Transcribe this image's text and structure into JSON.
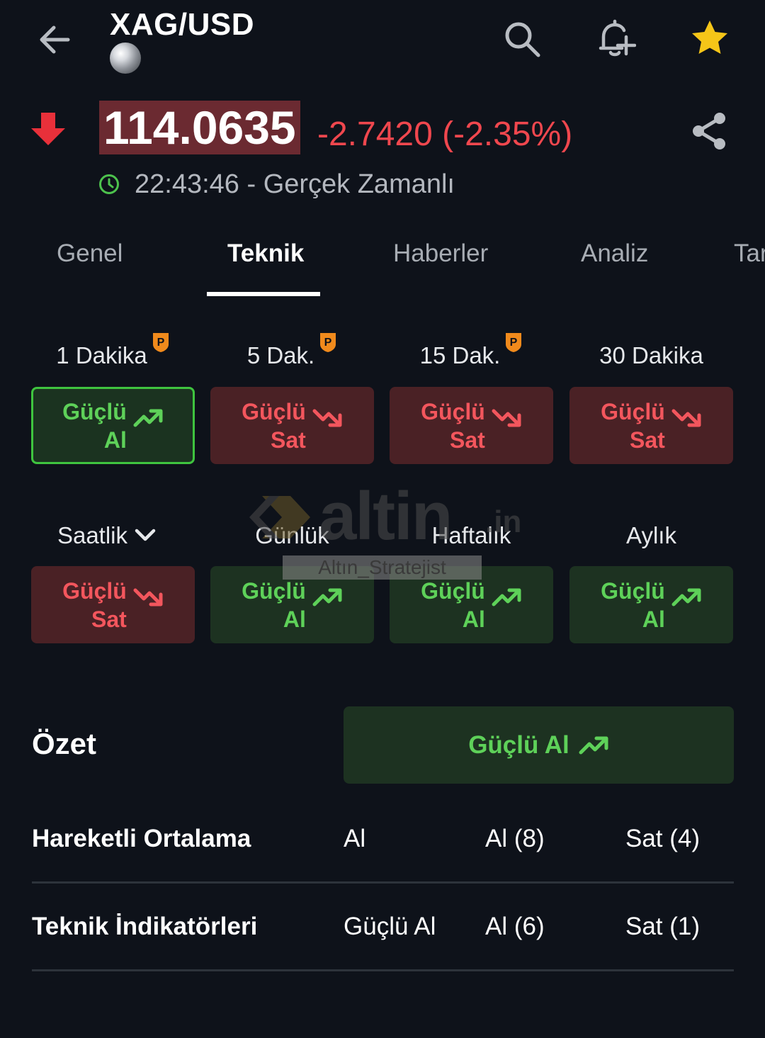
{
  "header": {
    "symbol": "XAG/USD",
    "icons": [
      "arrow-left-icon",
      "search-icon",
      "bell-plus-icon",
      "star-icon"
    ]
  },
  "quote": {
    "price": "114.0635",
    "change": "-2.7420 (-2.35%)",
    "direction": "down",
    "time_status": "22:43:46 - Gerçek Zamanlı"
  },
  "tabs": [
    {
      "label": "Genel",
      "active": false
    },
    {
      "label": "Teknik",
      "active": true
    },
    {
      "label": "Haberler",
      "active": false
    },
    {
      "label": "Analiz",
      "active": false
    },
    {
      "label": "Tar",
      "active": false
    }
  ],
  "timeframes_row1": [
    {
      "label": "1 Dakika",
      "pro": true,
      "signal_line1": "Güçlü",
      "signal_line2": "Al",
      "type": "buy",
      "selected": true
    },
    {
      "label": "5 Dak.",
      "pro": true,
      "signal_line1": "Güçlü",
      "signal_line2": "Sat",
      "type": "sell",
      "selected": false
    },
    {
      "label": "15 Dak.",
      "pro": true,
      "signal_line1": "Güçlü",
      "signal_line2": "Sat",
      "type": "sell",
      "selected": false
    },
    {
      "label": "30 Dakika",
      "pro": false,
      "signal_line1": "Güçlü",
      "signal_line2": "Sat",
      "type": "sell",
      "selected": false
    }
  ],
  "timeframes_row2": [
    {
      "label": "Saatlik",
      "dropdown": true,
      "signal_line1": "Güçlü",
      "signal_line2": "Sat",
      "type": "sell"
    },
    {
      "label": "Günlük",
      "signal_line1": "Güçlü",
      "signal_line2": "Al",
      "type": "buy"
    },
    {
      "label": "Haftalık",
      "signal_line1": "Güçlü",
      "signal_line2": "Al",
      "type": "buy"
    },
    {
      "label": "Aylık",
      "signal_line1": "Güçlü",
      "signal_line2": "Al",
      "type": "buy"
    }
  ],
  "watermark": {
    "brand": "altin",
    "suffix": ".in",
    "tag": "Altın_Stratejist"
  },
  "summary": {
    "title": "Özet",
    "signal": "Güçlü Al"
  },
  "rows": [
    {
      "name": "Hareketli Ortalama",
      "signal": "Al",
      "buy": "Al (8)",
      "sell": "Sat (4)"
    },
    {
      "name": "Teknik İndikatörleri",
      "signal": "Güçlü Al",
      "buy": "Al (6)",
      "sell": "Sat (1)"
    }
  ],
  "colors": {
    "background": "#0e121a",
    "buy": "#5ed159",
    "sell": "#f3565d",
    "buy_bg": "#1d3221",
    "sell_bg": "#4a2125",
    "star": "#f5c518",
    "pro_badge": "#f08a1c"
  }
}
